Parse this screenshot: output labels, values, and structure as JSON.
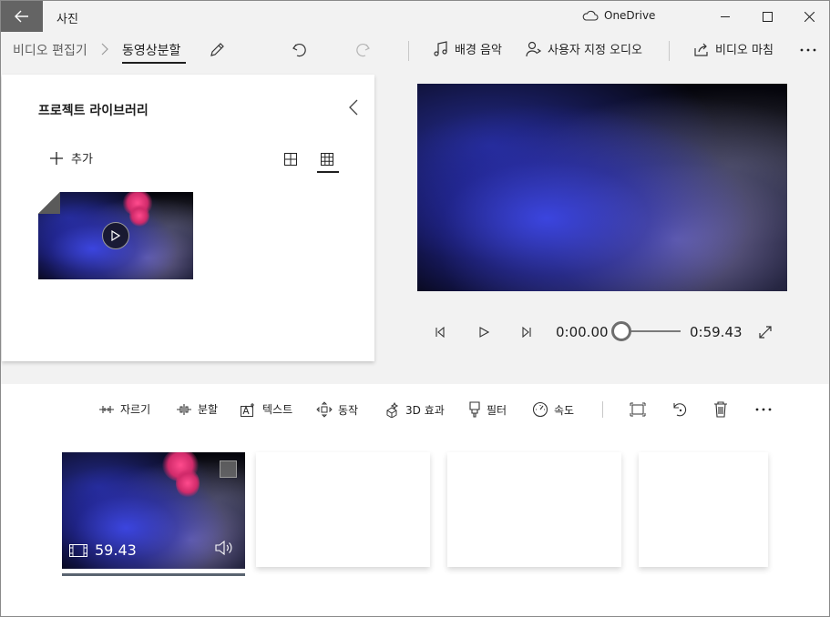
{
  "window": {
    "app_title": "사진",
    "onedrive_label": "OneDrive"
  },
  "toolbar": {
    "breadcrumb_parent": "비디오 편집기",
    "breadcrumb_current": "동영상분할",
    "background_music": "배경 음악",
    "custom_audio": "사용자 지정 오디오",
    "finish_video": "비디오 마침"
  },
  "library": {
    "title": "프로젝트 라이브러리",
    "add_label": "추가"
  },
  "player": {
    "current_time": "0:00.00",
    "total_time": "0:59.43",
    "progress": 0
  },
  "storyboard": {
    "tools": [
      {
        "label": "자르기",
        "icon": "trim-icon"
      },
      {
        "label": "분할",
        "icon": "split-icon"
      },
      {
        "label": "텍스트",
        "icon": "text-icon"
      },
      {
        "label": "동작",
        "icon": "motion-icon"
      },
      {
        "label": "3D 효과",
        "icon": "3d-effects-icon"
      },
      {
        "label": "필터",
        "icon": "filter-icon"
      },
      {
        "label": "속도",
        "icon": "speed-icon"
      }
    ],
    "clip_duration": "59.43"
  },
  "colors": {
    "accent_dark": "#646464",
    "panel_bg": "#f2f2f2",
    "card_bg": "#ffffff"
  }
}
